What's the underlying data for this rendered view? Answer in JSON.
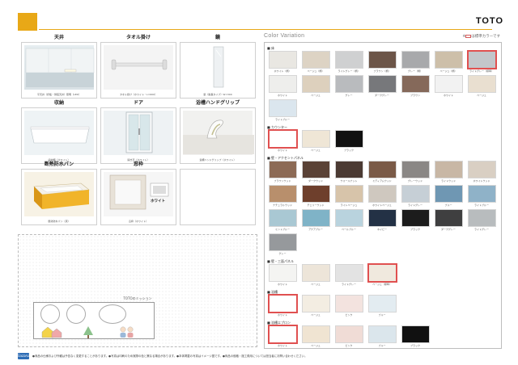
{
  "header": {
    "brand": "TOTO"
  },
  "options": [
    {
      "key": "ceiling",
      "title": "天井",
      "caption": "平天井（折板・鍋底天井）照明（LED）"
    },
    {
      "key": "towel",
      "title": "タオル掛け",
      "caption": "タオル掛け（ホワイト・L=600）"
    },
    {
      "key": "mirror",
      "title": "鏡",
      "caption": "鏡（縦長タイプ）W=300"
    },
    {
      "key": "storage",
      "title": "収納",
      "caption": "収納棚（ホワイト）"
    },
    {
      "key": "door",
      "title": "ドア",
      "caption": "開き戸（ホワイト）"
    },
    {
      "key": "grip",
      "title": "浴槽ハンドグリップ",
      "caption": "浴槽ハンドグリップ（ホワイト）"
    },
    {
      "key": "pan",
      "title": "断熱防水パン",
      "caption": "断熱防水パン（床）"
    },
    {
      "key": "window",
      "title": "窓枠",
      "caption": "窓枠（ホワイト）",
      "badge": "ホワイト"
    }
  ],
  "mission": {
    "title": "TOTOのミッション"
  },
  "palette": {
    "title": "Color Variation",
    "legend": "は標準カラーです",
    "colors": {
      "standard_marker": "#e05050",
      "accent": "#e8a817"
    },
    "groups": [
      {
        "label": "■ 床",
        "swatches": [
          {
            "name": "ホワイト（柄）",
            "color": "#e9e7e2"
          },
          {
            "name": "ベージュ（柄）",
            "color": "#ddd3c4"
          },
          {
            "name": "ライトグレー（柄）",
            "color": "#cfd0d1"
          },
          {
            "name": "ブラウン（柄）",
            "color": "#6c5548"
          },
          {
            "name": "グレー（柄）",
            "color": "#a8a9ab"
          },
          {
            "name": "ベージュ（柄）",
            "color": "#cdbfa9"
          },
          {
            "name": "ライトグレー（標準）",
            "color": "#c3c6ca",
            "standard": true
          },
          {
            "name": "ホワイト",
            "color": "#eeeeec"
          },
          {
            "name": "ベージュ",
            "color": "#ddd0bd"
          },
          {
            "name": "グレー",
            "color": "#b9bbbe"
          },
          {
            "name": "ダークグレー",
            "color": "#77787b"
          },
          {
            "name": "ブラウン",
            "color": "#85695a"
          },
          {
            "name": "ホワイト",
            "color": "#f2f2f2"
          },
          {
            "name": "ベージュ",
            "color": "#e9dfd0"
          },
          {
            "name": "ライトブルー",
            "color": "#dbe6ee"
          }
        ]
      },
      {
        "label": "■ カウンター",
        "swatches": [
          {
            "name": "ホワイト",
            "color": "#ffffff",
            "standard": true
          },
          {
            "name": "ベージュ",
            "color": "#efe6d6"
          },
          {
            "name": "ブラック",
            "color": "#111111"
          }
        ]
      },
      {
        "label": "■ 壁・アクセントパネル",
        "swatches": [
          {
            "name": "ブラウンウッド",
            "color": "#8c6a55"
          },
          {
            "name": "ダークウッド",
            "color": "#5a4236"
          },
          {
            "name": "ウォールナット",
            "color": "#4b3a33"
          },
          {
            "name": "ミディアムウッド",
            "color": "#7a5a47"
          },
          {
            "name": "グレーウッド",
            "color": "#8a8785"
          },
          {
            "name": "ライトウッド",
            "color": "#c8b7a5"
          },
          {
            "name": "ホワイトウッド",
            "color": "#d9cfc3"
          },
          {
            "name": "ナチュラルウッド",
            "color": "#b88f6c"
          },
          {
            "name": "チェリーウッド",
            "color": "#6e3f2c"
          },
          {
            "name": "ライトベージュ",
            "color": "#d7c4aa"
          },
          {
            "name": "ホワイトベージュ",
            "color": "#cfc8bf"
          },
          {
            "name": "ライトグレー",
            "color": "#c6cfd6"
          },
          {
            "name": "ブルー",
            "color": "#6f97b3"
          },
          {
            "name": "ライトブルー",
            "color": "#8fb2c8"
          },
          {
            "name": "ミントブルー",
            "color": "#a9c8d3"
          },
          {
            "name": "アクアブルー",
            "color": "#7fb3c7"
          },
          {
            "name": "ペールブルー",
            "color": "#b9d3de"
          },
          {
            "name": "ネイビー",
            "color": "#233145"
          },
          {
            "name": "ブラック",
            "color": "#1c1c1c"
          },
          {
            "name": "ダークグレー",
            "color": "#3f3f40"
          },
          {
            "name": "ライトグレー",
            "color": "#b8bcbe"
          },
          {
            "name": "グレー",
            "color": "#96999c"
          }
        ]
      },
      {
        "label": "■ 壁・三面パネル",
        "swatches": [
          {
            "name": "ホワイト",
            "color": "#f4f4f2"
          },
          {
            "name": "ベージュ",
            "color": "#ede5d9"
          },
          {
            "name": "ライトグレー",
            "color": "#e3e3e3"
          },
          {
            "name": "ベージュ（標準）",
            "color": "#f0e9de",
            "standard": true
          }
        ]
      },
      {
        "label": "■ 浴槽",
        "swatches": [
          {
            "name": "ホワイト",
            "color": "#ffffff",
            "standard": true
          },
          {
            "name": "ベージュ",
            "color": "#f3ede2"
          },
          {
            "name": "ピンク",
            "color": "#f3e3df"
          },
          {
            "name": "ブルー",
            "color": "#e3ecf1"
          }
        ]
      },
      {
        "label": "■ 浴槽エプロン",
        "swatches": [
          {
            "name": "ホワイト",
            "color": "#ffffff",
            "standard": true
          },
          {
            "name": "ベージュ",
            "color": "#f0e4d2"
          },
          {
            "name": "ピンク",
            "color": "#f0dcd6"
          },
          {
            "name": "ブルー",
            "color": "#dbe6ec"
          },
          {
            "name": "ブラック",
            "color": "#111111"
          }
        ]
      }
    ]
  },
  "footer": {
    "logo": "Sazanami",
    "text": "●商品の仕様および外観は予告なく変更することがあります。●写真は印刷のため実際の色と異なる場合があります。●本体掲載の写真はイメージ図です。●商品の価格・施工費用については担当者にお問い合わせください。"
  }
}
